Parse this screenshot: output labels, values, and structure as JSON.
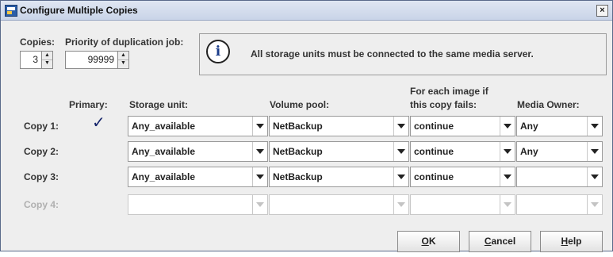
{
  "window": {
    "title": "Configure Multiple Copies",
    "close_glyph": "×"
  },
  "copies": {
    "label": "Copies:",
    "value": "3"
  },
  "priority": {
    "label": "Priority of duplication job:",
    "value": "99999"
  },
  "info": {
    "message": "All storage units must be connected to the same media server.",
    "icon": "info-icon"
  },
  "headers": {
    "primary": "Primary:",
    "storage_unit": "Storage unit:",
    "volume_pool": "Volume pool:",
    "fail_line1": "For each image if",
    "fail_line2": "this copy fails:",
    "media_owner": "Media Owner:"
  },
  "rows": [
    {
      "label": "Copy 1:",
      "primary_mark": "✓",
      "storage_unit": "Any_available",
      "volume_pool": "NetBackup",
      "on_fail": "continue",
      "media_owner": "Any",
      "enabled": true
    },
    {
      "label": "Copy 2:",
      "storage_unit": "Any_available",
      "volume_pool": "NetBackup",
      "on_fail": "continue",
      "media_owner": "Any",
      "enabled": true
    },
    {
      "label": "Copy 3:",
      "storage_unit": "Any_available",
      "volume_pool": "NetBackup",
      "on_fail": "continue",
      "media_owner": "",
      "enabled": true
    },
    {
      "label": "Copy 4:",
      "storage_unit": "",
      "volume_pool": "",
      "on_fail": "",
      "media_owner": "",
      "enabled": false
    }
  ],
  "buttons": {
    "ok": {
      "mnemonic": "O",
      "rest": "K"
    },
    "cancel": {
      "mnemonic": "C",
      "rest": "ancel"
    },
    "help": {
      "mnemonic": "H",
      "rest": "elp"
    }
  },
  "colors": {
    "title_bar": "#c9d4e8",
    "check": "#16256b",
    "disabled_text": "#b0b0b0"
  }
}
